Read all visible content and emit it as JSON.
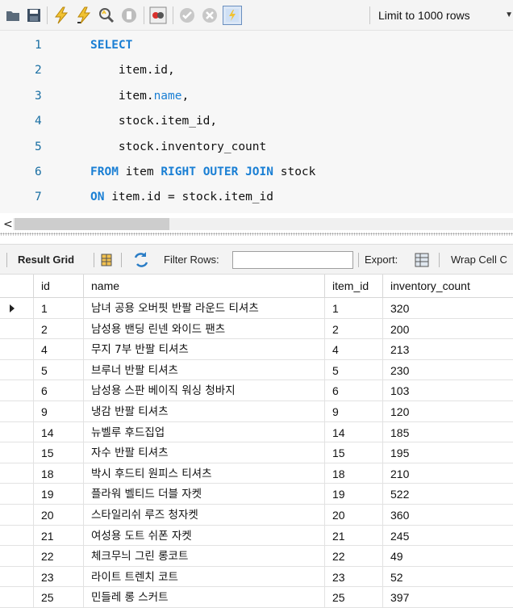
{
  "toolbar": {
    "icons": [
      "open-folder-icon",
      "save-icon",
      "execute-icon",
      "execute-current-icon",
      "explain-icon",
      "stop-icon",
      "toggle-error-icon",
      "commit-icon",
      "rollback-icon",
      "autocommit-icon"
    ],
    "limit_label": "Limit to 1000 rows"
  },
  "editor": {
    "lines": [
      {
        "n": "1",
        "tokens": [
          {
            "t": "SELECT",
            "c": "kw"
          }
        ]
      },
      {
        "n": "2",
        "tokens": [
          {
            "t": "    item.id,",
            "c": ""
          }
        ]
      },
      {
        "n": "3",
        "tokens": [
          {
            "t": "    item.",
            "c": ""
          },
          {
            "t": "name",
            "c": "fld"
          },
          {
            "t": ",",
            "c": ""
          }
        ]
      },
      {
        "n": "4",
        "tokens": [
          {
            "t": "    stock.item_id,",
            "c": ""
          }
        ]
      },
      {
        "n": "5",
        "tokens": [
          {
            "t": "    stock.inventory_count",
            "c": ""
          }
        ]
      },
      {
        "n": "6",
        "tokens": [
          {
            "t": "FROM",
            "c": "kw"
          },
          {
            "t": " item ",
            "c": ""
          },
          {
            "t": "RIGHT OUTER JOIN",
            "c": "kw"
          },
          {
            "t": " stock",
            "c": ""
          }
        ]
      },
      {
        "n": "7",
        "tokens": [
          {
            "t": "ON",
            "c": "kw"
          },
          {
            "t": " item.id = stock.item_id",
            "c": ""
          }
        ]
      }
    ]
  },
  "scroll": {
    "left_arrow": "<"
  },
  "result_toolbar": {
    "result_grid": "Result Grid",
    "filter_rows": "Filter Rows:",
    "filter_value": "",
    "export": "Export:",
    "wrap": "Wrap Cell C"
  },
  "grid": {
    "columns": [
      "id",
      "name",
      "item_id",
      "inventory_count"
    ],
    "rows": [
      [
        "1",
        "남녀 공용 오버핏 반팔 라운드 티셔츠",
        "1",
        "320"
      ],
      [
        "2",
        "남성용 밴딩 린넨 와이드 팬츠",
        "2",
        "200"
      ],
      [
        "4",
        "무지 7부 반팔 티셔츠",
        "4",
        "213"
      ],
      [
        "5",
        "브루너 반팔 티셔츠",
        "5",
        "230"
      ],
      [
        "6",
        "남성용 스판 베이직 워싱 청바지",
        "6",
        "103"
      ],
      [
        "9",
        "냉감 반팔 티셔츠",
        "9",
        "120"
      ],
      [
        "14",
        "뉴벨루 후드집업",
        "14",
        "185"
      ],
      [
        "15",
        "자수 반팔 티셔츠",
        "15",
        "195"
      ],
      [
        "18",
        "박시 후드티 원피스 티셔츠",
        "18",
        "210"
      ],
      [
        "19",
        "플라워 벨티드 더블 자켓",
        "19",
        "522"
      ],
      [
        "20",
        "스타일리쉬 루즈 청자켓",
        "20",
        "360"
      ],
      [
        "21",
        "여성용 도트 쉬폰 자켓",
        "21",
        "245"
      ],
      [
        "22",
        "체크무늬 그린 롱코트",
        "22",
        "49"
      ],
      [
        "23",
        "라이트 트렌치 코트",
        "23",
        "52"
      ],
      [
        "25",
        "민들레 롱 스커트",
        "25",
        "397"
      ]
    ]
  }
}
